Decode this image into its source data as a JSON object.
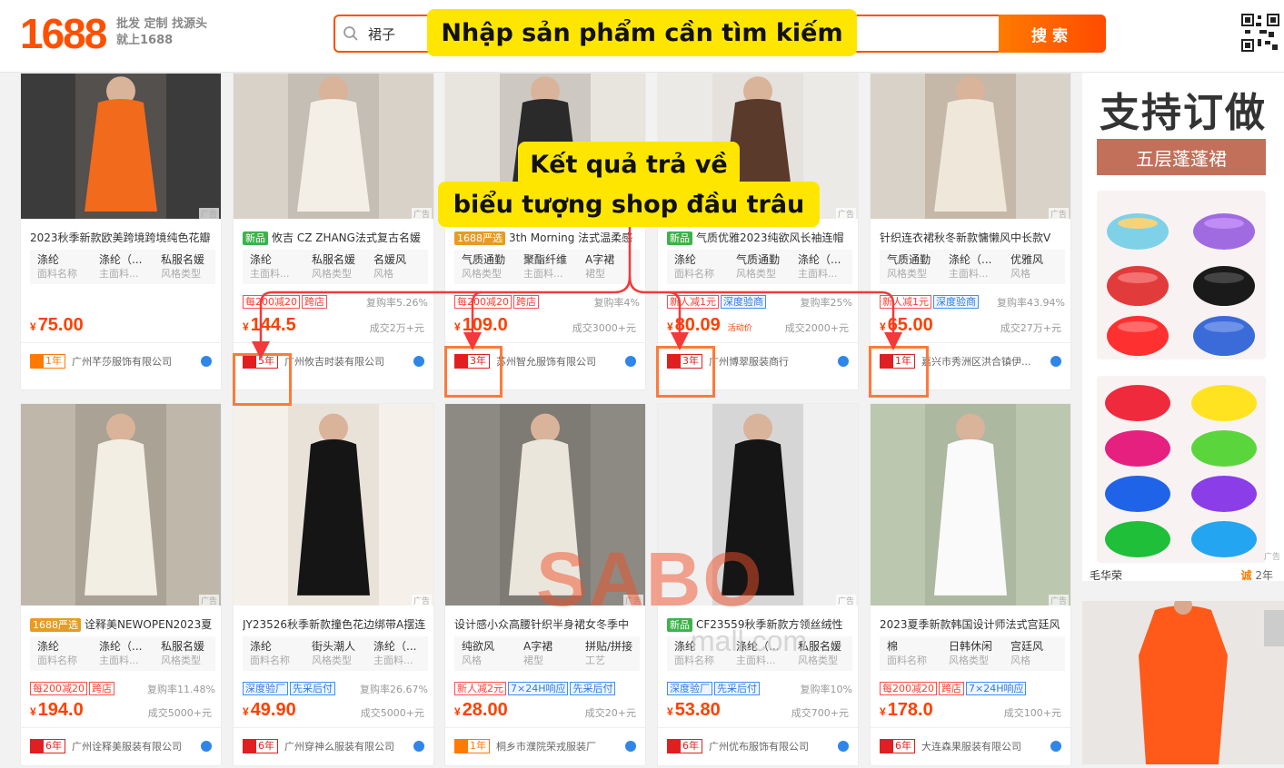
{
  "header": {
    "logo": "1688",
    "slogan_line1": "批发 定制 找源头",
    "slogan_line2": "就上1688",
    "search_value": "裙子",
    "search_button": "搜索"
  },
  "annotations": {
    "search": "Nhập sản phẩm cần tìm kiếm",
    "result_line1": "Kết quả trả về",
    "result_line2": "biểu tượng shop đầu trâu"
  },
  "watermark": {
    "main": "SABO",
    "sub": "mall.com"
  },
  "ad_label": "广告",
  "products_row1": [
    {
      "title": "2023秋季新款欧美跨境跨境纯色花瓣",
      "badge": "",
      "attrs": [
        [
          "涤纶",
          "面料名称"
        ],
        [
          "涤纶（...",
          "主面料..."
        ],
        [
          "私服名媛",
          "风格类型"
        ]
      ],
      "tags": [],
      "rate": "",
      "price": "75.00",
      "promo": "",
      "deals": "",
      "year": "1年",
      "shop": "广州芊莎服饰有限公司",
      "shop_icon": "cheng"
    },
    {
      "title": "攸吉 CZ ZHANG法式复古名媛",
      "badge": "新品",
      "attrs": [
        [
          "涤纶",
          "主面料..."
        ],
        [
          "私服名媛",
          "风格类型"
        ],
        [
          "名媛风",
          "风格"
        ]
      ],
      "tags": [
        [
          "每200减20",
          "r"
        ],
        [
          "跨店",
          "r"
        ]
      ],
      "rate": "复购率5.26%",
      "price": "144.5",
      "promo": "",
      "deals": "成交2万+元",
      "year": "5年",
      "shop": "广州攸吉时装有限公司",
      "shop_icon": "niu"
    },
    {
      "title": "3th Morning 法式温柔感",
      "badge": "1688严选",
      "attrs": [
        [
          "气质通勤",
          "风格类型"
        ],
        [
          "聚酯纤维",
          "主面料..."
        ],
        [
          "A字裙",
          "裙型"
        ]
      ],
      "tags": [
        [
          "每200减20",
          "r"
        ],
        [
          "跨店",
          "r"
        ]
      ],
      "rate": "复购率4%",
      "price": "109.0",
      "promo": "",
      "deals": "成交3000+元",
      "year": "3年",
      "shop": "苏州智允服饰有限公司",
      "shop_icon": "niu"
    },
    {
      "title": "气质优雅2023纯欲风长袖连帽",
      "badge": "新品",
      "attrs": [
        [
          "涤纶",
          "面料名称"
        ],
        [
          "气质通勤",
          "风格类型"
        ],
        [
          "涤纶（...",
          "主面料..."
        ]
      ],
      "tags": [
        [
          "新人减1元",
          "r"
        ],
        [
          "深度验商",
          "b"
        ]
      ],
      "rate": "复购率25%",
      "price": "80.09",
      "promo": "活动价",
      "deals": "成交2000+元",
      "year": "3年",
      "shop": "广州博翠服装商行",
      "shop_icon": "niu"
    },
    {
      "title": "针织连衣裙秋冬新款慵懒风中长款V",
      "badge": "",
      "attrs": [
        [
          "气质通勤",
          "风格类型"
        ],
        [
          "涤纶（...",
          "主面料..."
        ],
        [
          "优雅风",
          "风格"
        ]
      ],
      "tags": [
        [
          "新人减1元",
          "r"
        ],
        [
          "深度验商",
          "b"
        ]
      ],
      "rate": "复购率43.94%",
      "price": "65.00",
      "promo": "",
      "deals": "成交27万+元",
      "year": "1年",
      "shop": "嘉兴市秀洲区洪合镇伊...",
      "shop_icon": "niu"
    }
  ],
  "products_row2": [
    {
      "title": "诠释美NEWOPEN2023夏",
      "badge": "1688严选",
      "attrs": [
        [
          "涤纶",
          "面料名称"
        ],
        [
          "涤纶（...",
          "主面料..."
        ],
        [
          "私服名媛",
          "风格类型"
        ]
      ],
      "tags": [
        [
          "每200减20",
          "r"
        ],
        [
          "跨店",
          "r"
        ]
      ],
      "rate": "复购率11.48%",
      "price": "194.0",
      "deals": "成交5000+元",
      "year": "6年",
      "shop": "广州诠释美服装有限公司",
      "shop_icon": "niu"
    },
    {
      "title": "JY23526秋季新款撞色花边绑带A摆连",
      "badge": "",
      "attrs": [
        [
          "涤纶",
          "面料名称"
        ],
        [
          "街头潮人",
          "风格类型"
        ],
        [
          "涤纶（...",
          "主面料..."
        ]
      ],
      "tags": [
        [
          "深度验厂",
          "b"
        ],
        [
          "先采后付",
          "b"
        ]
      ],
      "rate": "复购率26.67%",
      "price": "49.90",
      "deals": "成交5000+元",
      "year": "6年",
      "shop": "广州穿神么服装有限公司",
      "shop_icon": "niu"
    },
    {
      "title": "设计感小众高腰针织半身裙女冬季中",
      "badge": "",
      "attrs": [
        [
          "纯欲风",
          "风格"
        ],
        [
          "A字裙",
          "裙型"
        ],
        [
          "拼贴/拼接",
          "工艺"
        ]
      ],
      "tags": [
        [
          "新人减2元",
          "r"
        ],
        [
          "7×24H响应",
          "b"
        ],
        [
          "先采后付",
          "b"
        ]
      ],
      "rate": "",
      "price": "28.00",
      "deals": "成交20+元",
      "year": "1年",
      "shop": "桐乡市濮院荣戎服装厂",
      "shop_icon": "cheng"
    },
    {
      "title": "CF23559秋季新款方领丝绒性",
      "badge": "新品",
      "attrs": [
        [
          "涤纶",
          "面料名称"
        ],
        [
          "涤纶（...",
          "主面料..."
        ],
        [
          "私服名媛",
          "风格类型"
        ]
      ],
      "tags": [
        [
          "深度验厂",
          "b"
        ],
        [
          "先采后付",
          "b"
        ]
      ],
      "rate": "复购率10%",
      "price": "53.80",
      "deals": "成交700+元",
      "year": "6年",
      "shop": "广州优布服饰有限公司",
      "shop_icon": "niu"
    },
    {
      "title": "2023夏季新款韩国设计师法式宫廷风",
      "badge": "",
      "attrs": [
        [
          "棉",
          "面料名称"
        ],
        [
          "日韩休闲",
          "风格类型"
        ],
        [
          "宫廷风",
          "风格"
        ]
      ],
      "tags": [
        [
          "每200减20",
          "r"
        ],
        [
          "跨店",
          "r"
        ],
        [
          "7×24H响应",
          "b"
        ]
      ],
      "rate": "",
      "price": "178.0",
      "deals": "成交100+元",
      "year": "6年",
      "shop": "大连森果服装有限公司",
      "shop_icon": "niu"
    }
  ],
  "side_ad": {
    "headline": "支持订做",
    "sub": "五层蓬蓬裙",
    "shop": "毛华荣",
    "year": "2年"
  },
  "currency": "¥"
}
